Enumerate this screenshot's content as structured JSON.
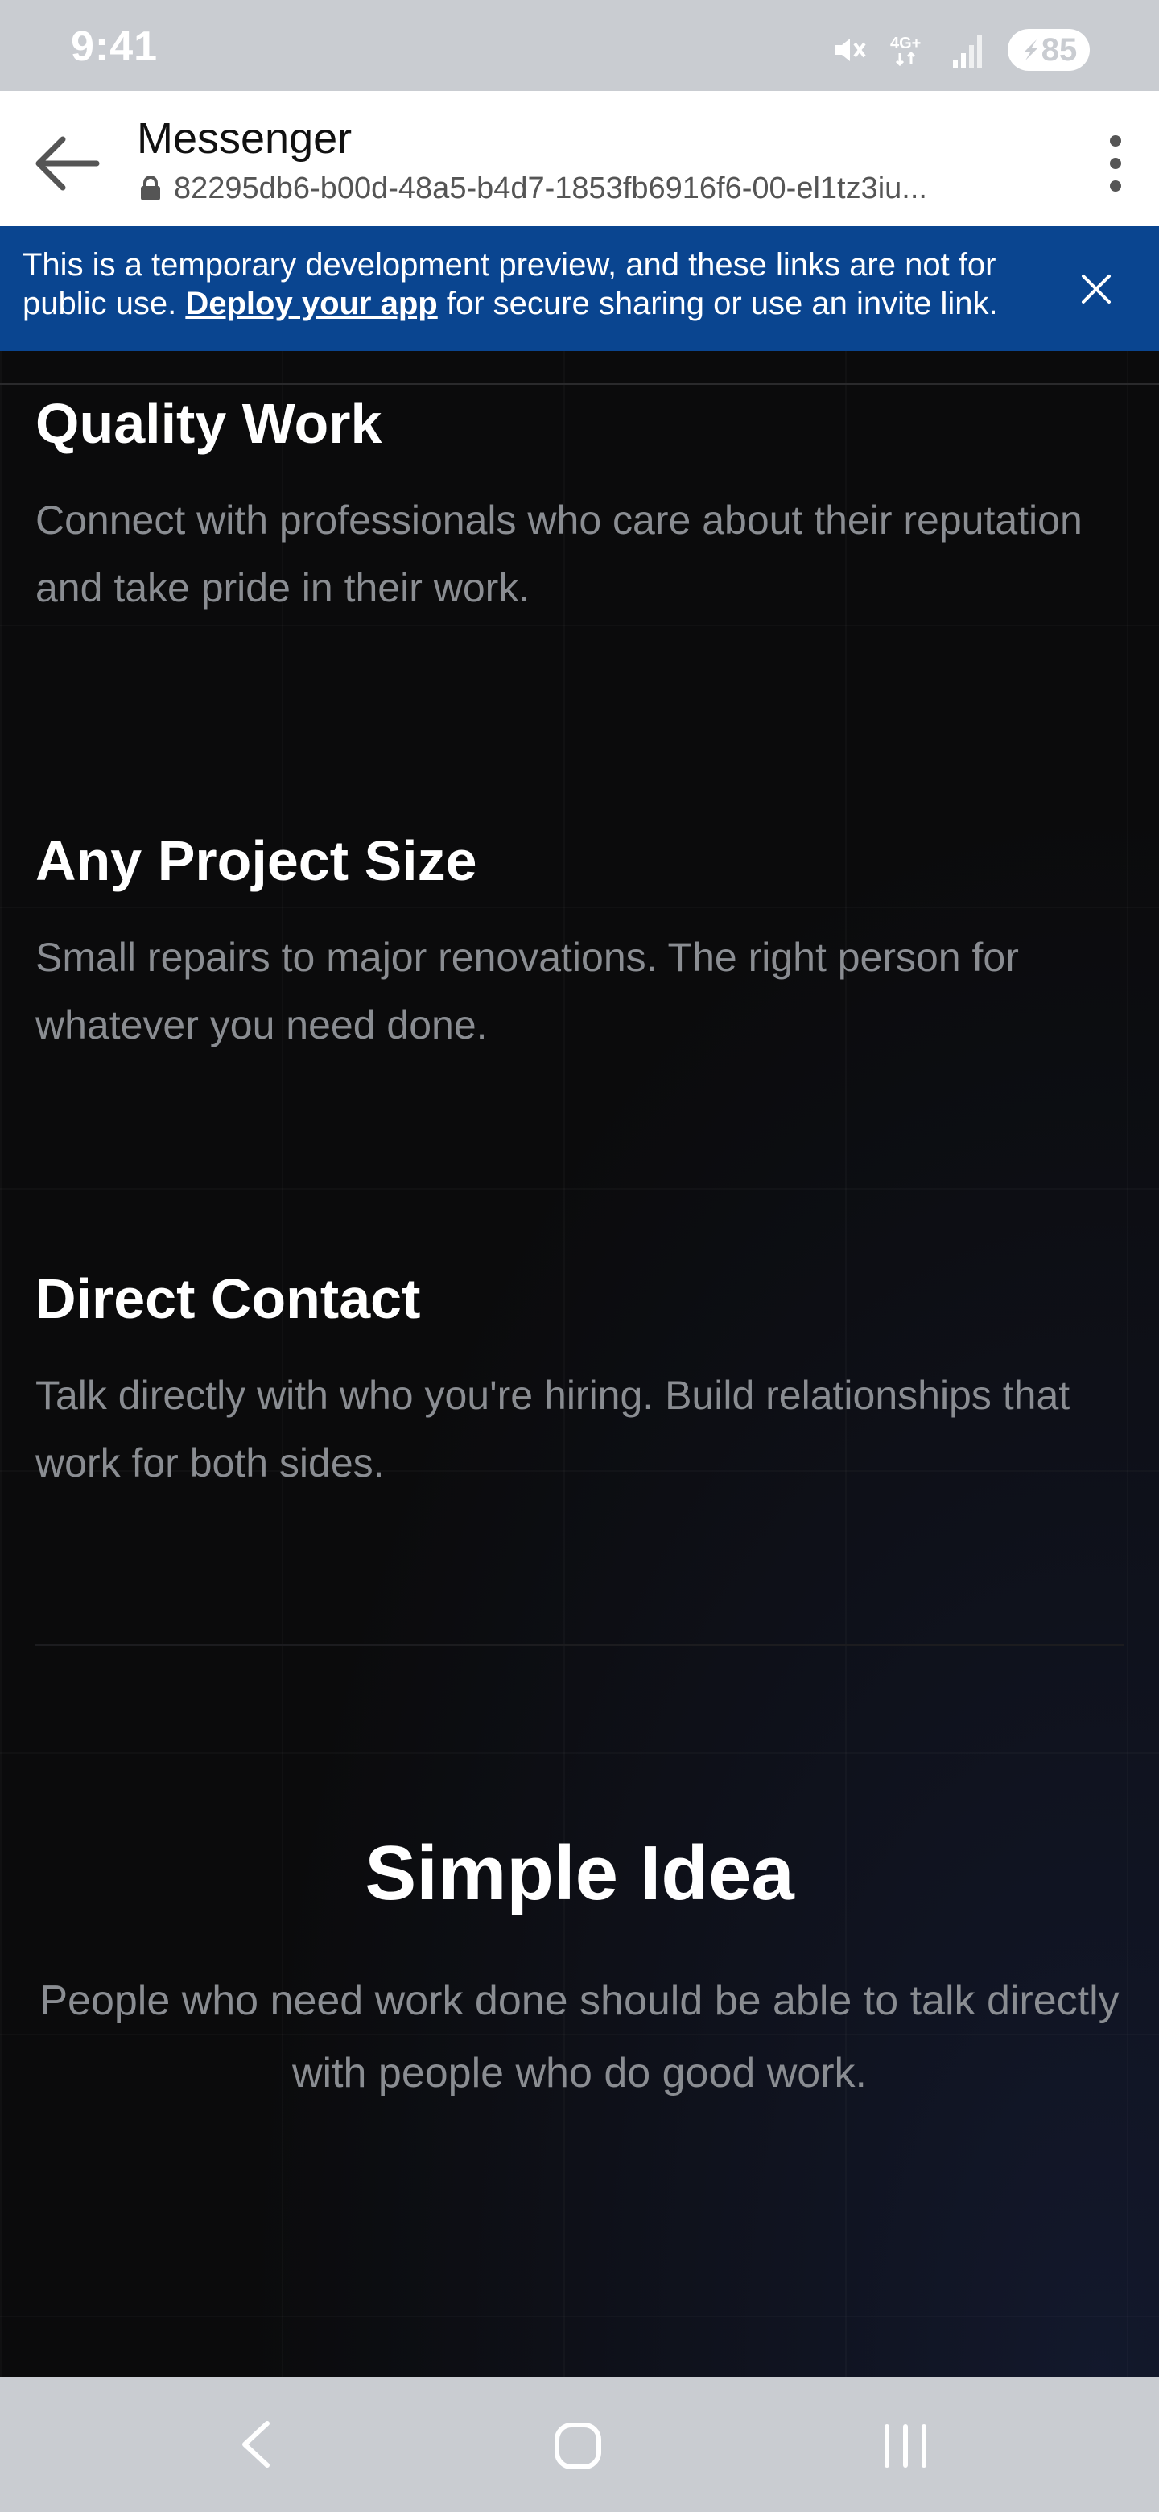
{
  "status_bar": {
    "time": "9:41",
    "battery": "85",
    "icons": [
      "mute-icon",
      "4g-icon",
      "signal-icon",
      "battery-icon"
    ]
  },
  "header": {
    "title": "Messenger",
    "url": "82295db6-b00d-48a5-b4d7-1853fb6916f6-00-el1tz3iu...",
    "back_icon": "arrow-left-icon",
    "menu_icon": "more-vertical-icon"
  },
  "banner": {
    "text_before": "This is a temporary development preview, and these links are not for public use. ",
    "link": "Deploy your app",
    "text_after": " for secure sharing or use an invite link.",
    "close_icon": "close-icon",
    "background": "#0a4590"
  },
  "features": [
    {
      "title": "Quality Work",
      "text": "Connect with professionals who care about their reputation and take pride in their work."
    },
    {
      "title": "Any Project Size",
      "text": "Small repairs to major renovations. The right person for whatever you need done."
    },
    {
      "title": "Direct Contact",
      "text": "Talk directly with who you're hiring. Build relationships that work for both sides."
    }
  ],
  "simple_idea": {
    "title": "Simple Idea",
    "text": "People who need work done should be able to talk directly with people who do good work."
  },
  "nav_bar": {
    "icons": [
      "back-icon",
      "home-icon",
      "recents-icon"
    ]
  }
}
